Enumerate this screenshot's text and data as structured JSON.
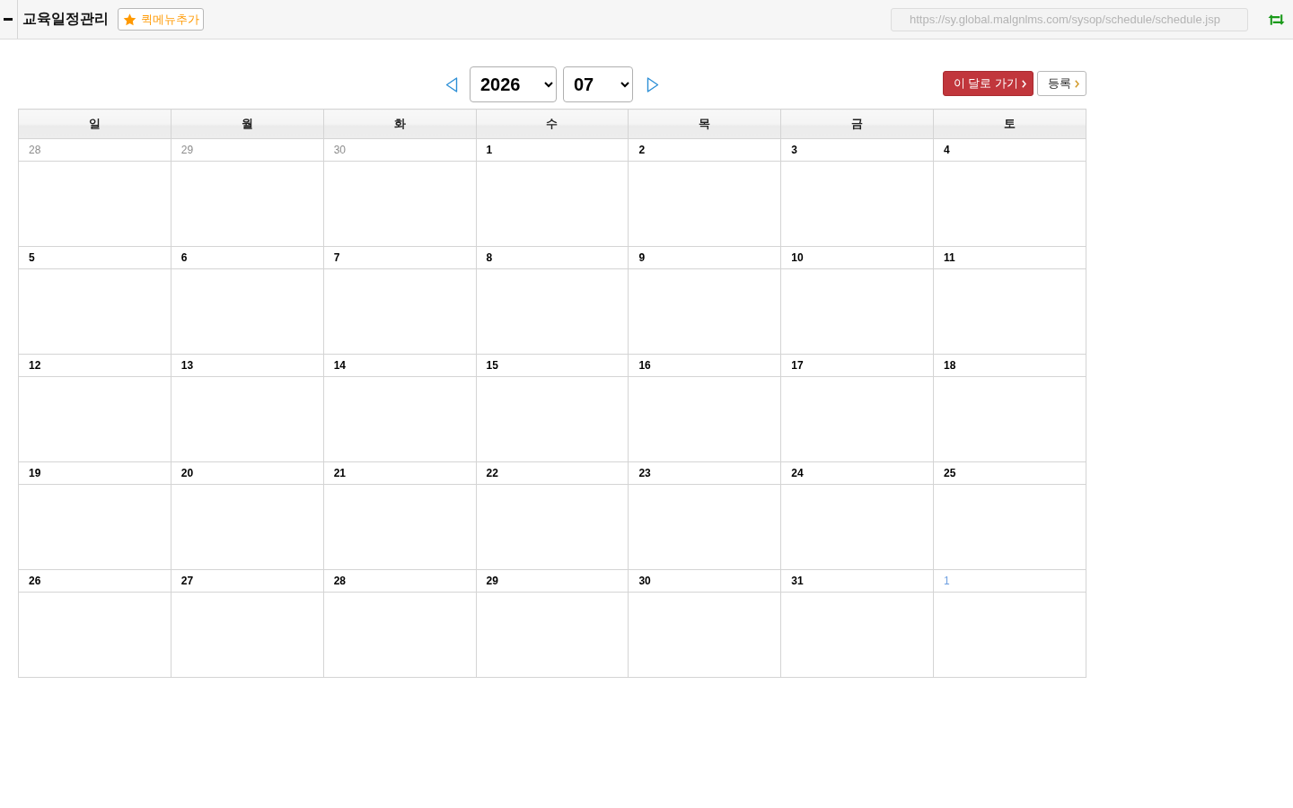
{
  "header": {
    "title": "교육일정관리",
    "quick_menu_button": "퀵메뉴추가",
    "url": "https://sy.global.malgnlms.com/sysop/schedule/schedule.jsp"
  },
  "navigation": {
    "year": "2026",
    "month": "07"
  },
  "buttons": [
    {
      "label": "이 달로 가기",
      "kind": "primary"
    },
    {
      "label": "등록",
      "kind": "secondary"
    }
  ],
  "calendar": {
    "weekdays": [
      "일",
      "월",
      "화",
      "수",
      "목",
      "금",
      "토"
    ],
    "weeks": [
      [
        {
          "day": "28",
          "other_month": true
        },
        {
          "day": "29",
          "other_month": true
        },
        {
          "day": "30",
          "other_month": true
        },
        {
          "day": "1",
          "other_month": false
        },
        {
          "day": "2",
          "other_month": false
        },
        {
          "day": "3",
          "other_month": false
        },
        {
          "day": "4",
          "other_month": false
        }
      ],
      [
        {
          "day": "5",
          "other_month": false
        },
        {
          "day": "6",
          "other_month": false
        },
        {
          "day": "7",
          "other_month": false
        },
        {
          "day": "8",
          "other_month": false
        },
        {
          "day": "9",
          "other_month": false
        },
        {
          "day": "10",
          "other_month": false
        },
        {
          "day": "11",
          "other_month": false
        }
      ],
      [
        {
          "day": "12",
          "other_month": false
        },
        {
          "day": "13",
          "other_month": false
        },
        {
          "day": "14",
          "other_month": false
        },
        {
          "day": "15",
          "other_month": false
        },
        {
          "day": "16",
          "other_month": false
        },
        {
          "day": "17",
          "other_month": false
        },
        {
          "day": "18",
          "other_month": false
        }
      ],
      [
        {
          "day": "19",
          "other_month": false
        },
        {
          "day": "20",
          "other_month": false
        },
        {
          "day": "21",
          "other_month": false
        },
        {
          "day": "22",
          "other_month": false
        },
        {
          "day": "23",
          "other_month": false
        },
        {
          "day": "24",
          "other_month": false
        },
        {
          "day": "25",
          "other_month": false
        }
      ],
      [
        {
          "day": "26",
          "other_month": false
        },
        {
          "day": "27",
          "other_month": false
        },
        {
          "day": "28",
          "other_month": false
        },
        {
          "day": "29",
          "other_month": false
        },
        {
          "day": "30",
          "other_month": false
        },
        {
          "day": "31",
          "other_month": false
        },
        {
          "day": "1",
          "other_month": true
        }
      ]
    ]
  }
}
